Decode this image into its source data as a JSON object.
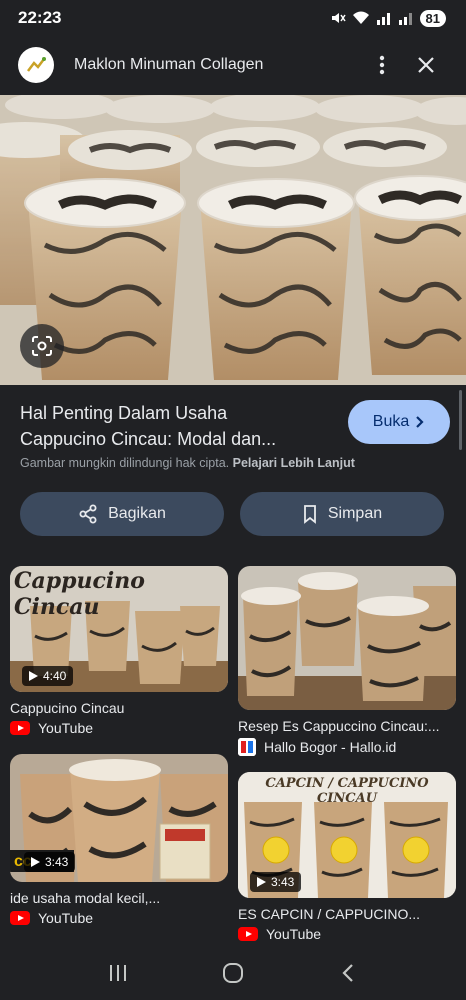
{
  "status_bar": {
    "time": "22:23",
    "battery": "81"
  },
  "header": {
    "site_name": "Maklon Minuman Collagen"
  },
  "result": {
    "title_line1": "Hal Penting Dalam Usaha",
    "title_line2": "Cappucino Cincau: Modal dan...",
    "open_label": "Buka",
    "copyright_text": "Gambar mungkin dilindungi hak cipta.",
    "learn_more": "Pelajari Lebih Lanjut"
  },
  "actions": {
    "share_label": "Bagikan",
    "save_label": "Simpan"
  },
  "related": [
    {
      "overlay": "Cappucino Cincau",
      "duration": "4:40",
      "title": "Cappucino Cincau",
      "source": "YouTube",
      "source_icon": "youtube-icon"
    },
    {
      "overlay": "",
      "duration": "",
      "title": "Resep Es Cappuccino Cincau:...",
      "source": "Hallo Bogor - Hallo.id",
      "source_icon": "hallo-icon"
    },
    {
      "overlay": "",
      "duration": "3:43",
      "title": "ide usaha modal kecil,...",
      "source": "YouTube",
      "source_icon": "youtube-icon"
    },
    {
      "overlay": "CAPCIN / CAPPUCINO CINCAU",
      "duration": "3:43",
      "title": "ES CAPCIN / CAPPUCINO...",
      "source": "YouTube",
      "source_icon": "youtube-icon"
    }
  ],
  "colors": {
    "background": "#202124",
    "accent_button": "#a8c7fa",
    "action_button": "#3c4a5e",
    "youtube_red": "#ff0000"
  }
}
